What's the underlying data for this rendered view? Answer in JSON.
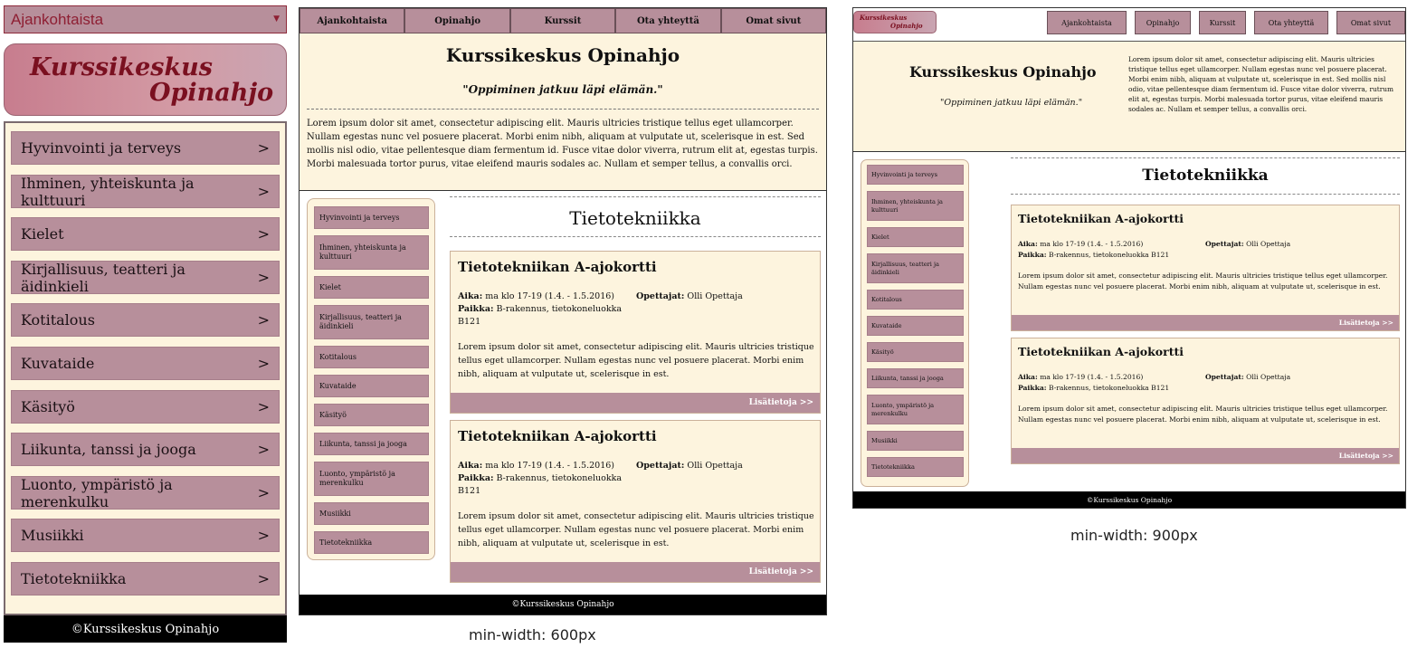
{
  "site": {
    "name": "Kurssikeskus Opinahjo",
    "logo_line1": "Kurssikeskus",
    "logo_line2": "Opinahjo",
    "slogan": "\"Oppiminen jatkuu läpi elämän.\"",
    "intro": "Lorem ipsum dolor sit amet, consectetur adipiscing elit. Mauris ultricies tristique tellus eget ullamcorper. Nullam egestas nunc vel posuere placerat. Morbi enim nibh, aliquam at vulputate ut, scelerisque in est. Sed mollis nisl odio, vitae pellentesque diam fermentum id. Fusce vitae dolor viverra, rutrum elit at, egestas turpis. Morbi malesuada tortor purus, vitae eleifend mauris sodales ac. Nullam et semper tellus, a convallis orci.",
    "footer": "©Kurssikeskus Opinahjo"
  },
  "nav": [
    "Ajankohtaista",
    "Opinahjo",
    "Kurssit",
    "Ota yhteyttä",
    "Omat sivut"
  ],
  "mobile_select": {
    "value": "Ajankohtaista",
    "arrow": "▼"
  },
  "categories": [
    "Hyvinvointi ja terveys",
    "Ihminen, yhteiskunta ja kulttuuri",
    "Kielet",
    "Kirjallisuus, teatteri ja äidinkieli",
    "Kotitalous",
    "Kuvataide",
    "Käsityö",
    "Liikunta, tanssi ja jooga",
    "Luonto, ympäristö ja merenkulku",
    "Musiikki",
    "Tietotekniikka"
  ],
  "chevron": ">",
  "section_title": "Tietotekniikka",
  "course": {
    "title": "Tietotekniikan A-ajokortti",
    "time_label": "Aika:",
    "time_value": "ma klo 17-19 (1.4. - 1.5.2016)",
    "place_label": "Paikka:",
    "place_value": "B-rakennus, tietokoneluokka B121",
    "teacher_label": "Opettajat:",
    "teacher_value": "Olli Opettaja",
    "description": "Lorem ipsum dolor sit amet, consectetur adipiscing elit. Mauris ultricies tristique tellus eget ullamcorper. Nullam egestas nunc vel posuere placerat. Morbi enim nibh, aliquam at vulputate ut, scelerisque in est.",
    "more_link": "Lisätietoja >>"
  },
  "captions": {
    "p2": "min-width: 600px",
    "p3": "min-width: 900px"
  },
  "colors": {
    "mauve": "#b78f9b",
    "cream": "#fdf4de",
    "logo_text": "#7a1020",
    "select_text": "#8e1f33"
  }
}
